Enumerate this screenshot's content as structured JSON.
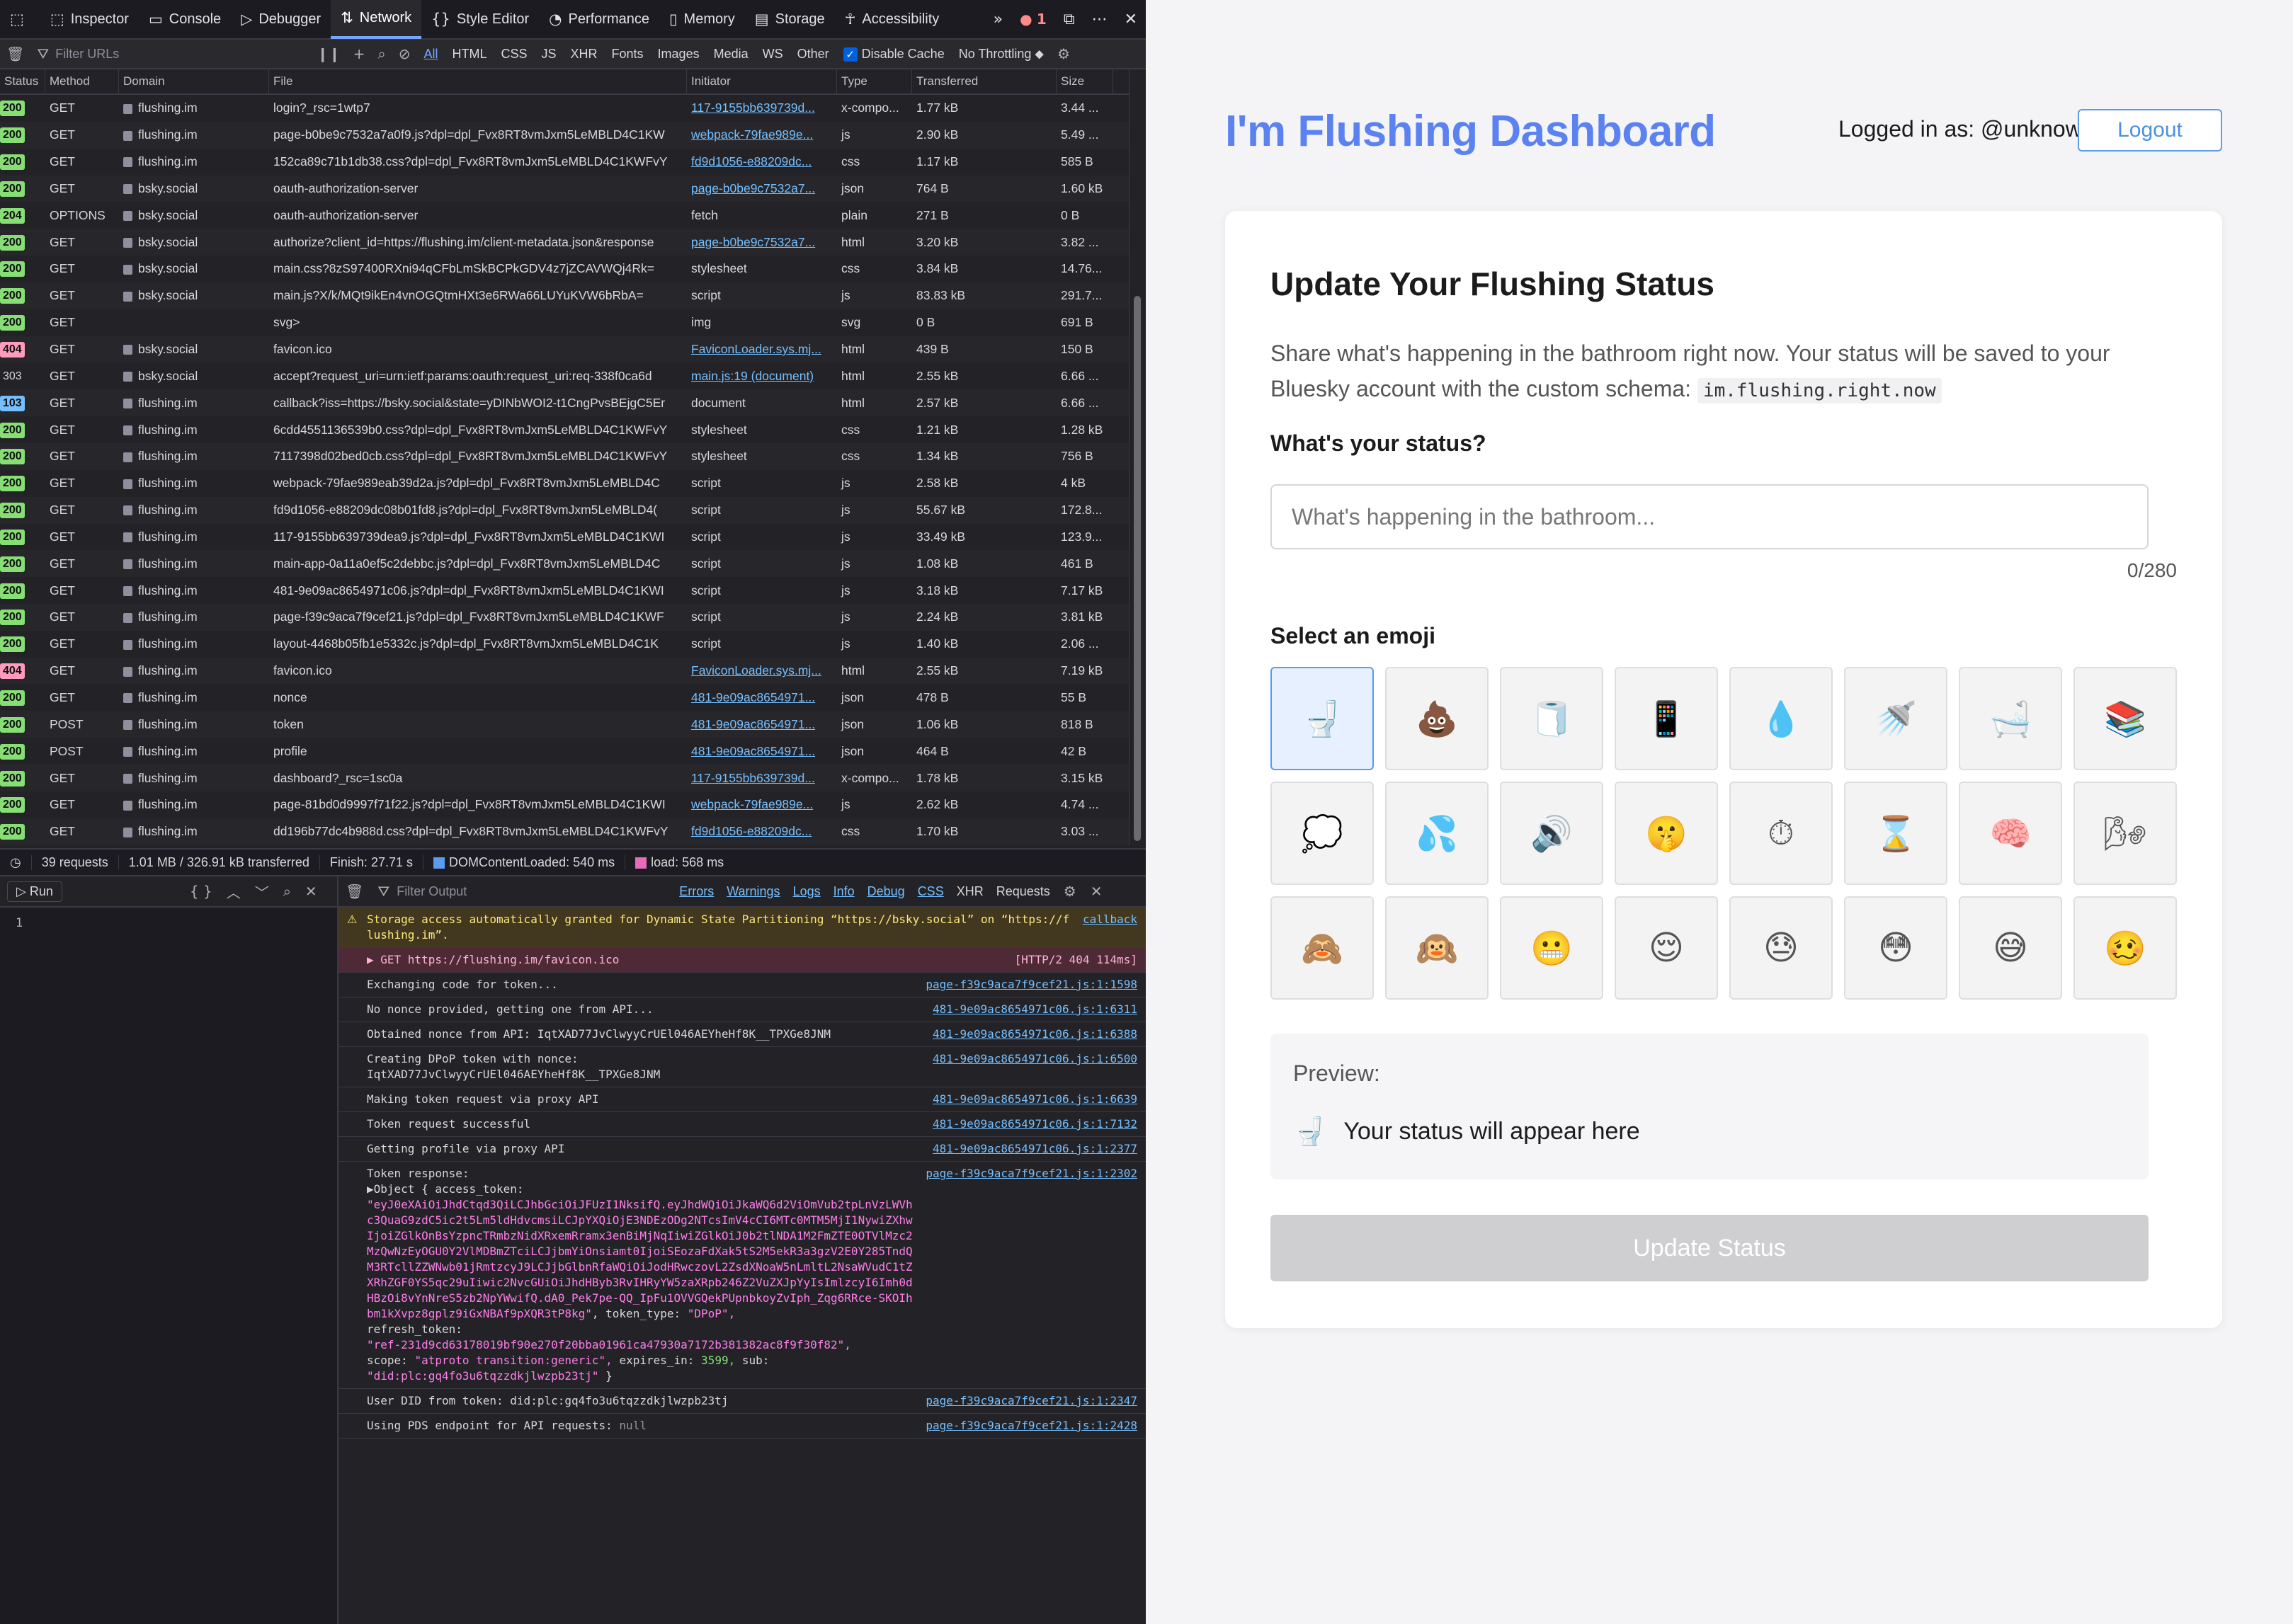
{
  "devtools": {
    "tools": [
      "Inspector",
      "Console",
      "Debugger",
      "Network",
      "Style Editor",
      "Performance",
      "Memory",
      "Storage",
      "Accessibility"
    ],
    "error_count": "1",
    "filter_placeholder": "Filter URLs",
    "filter_types": [
      "All",
      "HTML",
      "CSS",
      "JS",
      "XHR",
      "Fonts",
      "Images",
      "Media",
      "WS",
      "Other"
    ],
    "disable_cache": "Disable Cache",
    "throttling": "No Throttling ⬥",
    "columns": [
      "Status",
      "Method",
      "Domain",
      "File",
      "Initiator",
      "Type",
      "Transferred",
      "Size"
    ],
    "requests": [
      [
        "200",
        "GET",
        "flushing.im",
        "login?_rsc=1wtp7",
        "117-9155bb639739d...",
        "x-compo...",
        "1.77 kB",
        "3.44 ..."
      ],
      [
        "200",
        "GET",
        "flushing.im",
        "page-b0be9c7532a7a0f9.js?dpl=dpl_Fvx8RT8vmJxm5LeMBLD4C1KW",
        "webpack-79fae989e...",
        "js",
        "2.90 kB",
        "5.49 ..."
      ],
      [
        "200",
        "GET",
        "flushing.im",
        "152ca89c71b1db38.css?dpl=dpl_Fvx8RT8vmJxm5LeMBLD4C1KWFvY",
        "fd9d1056-e88209dc...",
        "css",
        "1.17 kB",
        "585 B"
      ],
      [
        "200",
        "GET",
        "bsky.social",
        "oauth-authorization-server",
        "page-b0be9c7532a7...",
        "json",
        "764 B",
        "1.60 kB"
      ],
      [
        "204",
        "OPTIONS",
        "bsky.social",
        "oauth-authorization-server",
        "fetch",
        "plain",
        "271 B",
        "0 B"
      ],
      [
        "200",
        "GET",
        "bsky.social",
        "authorize?client_id=https://flushing.im/client-metadata.json&response",
        "page-b0be9c7532a7...",
        "html",
        "3.20 kB",
        "3.82 ..."
      ],
      [
        "200",
        "GET",
        "bsky.social",
        "main.css?8zS97400RXni94qCFbLmSkBCPkGDV4z7jZCAVWQj4Rk=",
        "stylesheet",
        "css",
        "3.84 kB",
        "14.76..."
      ],
      [
        "200",
        "GET",
        "bsky.social",
        "main.js?X/k/MQt9ikEn4vnOGQtmHXt3e6RWa66LUYuKVW6bRbA=",
        "script",
        "js",
        "83.83 kB",
        "291.7..."
      ],
      [
        "200",
        "GET",
        "",
        "svg>",
        "img",
        "svg",
        "0 B",
        "691 B"
      ],
      [
        "404",
        "GET",
        "bsky.social",
        "favicon.ico",
        "FaviconLoader.sys.mj...",
        "html",
        "439 B",
        "150 B"
      ],
      [
        "303",
        "GET",
        "bsky.social",
        "accept?request_uri=urn:ietf:params:oauth:request_uri:req-338f0ca6d",
        "main.js:19 (document)",
        "html",
        "2.55 kB",
        "6.66 ..."
      ],
      [
        "103",
        "GET",
        "flushing.im",
        "callback?iss=https://bsky.social&state=yDINbWOI2-t1CngPvsBEjgC5Er",
        "document",
        "html",
        "2.57 kB",
        "6.66 ..."
      ],
      [
        "200",
        "GET",
        "flushing.im",
        "6cdd4551136539b0.css?dpl=dpl_Fvx8RT8vmJxm5LeMBLD4C1KWFvY",
        "stylesheet",
        "css",
        "1.21 kB",
        "1.28 kB"
      ],
      [
        "200",
        "GET",
        "flushing.im",
        "7117398d02bed0cb.css?dpl=dpl_Fvx8RT8vmJxm5LeMBLD4C1KWFvY",
        "stylesheet",
        "css",
        "1.34 kB",
        "756 B"
      ],
      [
        "200",
        "GET",
        "flushing.im",
        "webpack-79fae989eab39d2a.js?dpl=dpl_Fvx8RT8vmJxm5LeMBLD4C",
        "script",
        "js",
        "2.58 kB",
        "4 kB"
      ],
      [
        "200",
        "GET",
        "flushing.im",
        "fd9d1056-e88209dc08b01fd8.js?dpl=dpl_Fvx8RT8vmJxm5LeMBLD4(",
        "script",
        "js",
        "55.67 kB",
        "172.8..."
      ],
      [
        "200",
        "GET",
        "flushing.im",
        "117-9155bb639739dea9.js?dpl=dpl_Fvx8RT8vmJxm5LeMBLD4C1KWI",
        "script",
        "js",
        "33.49 kB",
        "123.9..."
      ],
      [
        "200",
        "GET",
        "flushing.im",
        "main-app-0a11a0ef5c2debbc.js?dpl=dpl_Fvx8RT8vmJxm5LeMBLD4C",
        "script",
        "js",
        "1.08 kB",
        "461 B"
      ],
      [
        "200",
        "GET",
        "flushing.im",
        "481-9e09ac8654971c06.js?dpl=dpl_Fvx8RT8vmJxm5LeMBLD4C1KWI",
        "script",
        "js",
        "3.18 kB",
        "7.17 kB"
      ],
      [
        "200",
        "GET",
        "flushing.im",
        "page-f39c9aca7f9cef21.js?dpl=dpl_Fvx8RT8vmJxm5LeMBLD4C1KWF",
        "script",
        "js",
        "2.24 kB",
        "3.81 kB"
      ],
      [
        "200",
        "GET",
        "flushing.im",
        "layout-4468b05fb1e5332c.js?dpl=dpl_Fvx8RT8vmJxm5LeMBLD4C1K",
        "script",
        "js",
        "1.40 kB",
        "2.06 ..."
      ],
      [
        "404",
        "GET",
        "flushing.im",
        "favicon.ico",
        "FaviconLoader.sys.mj...",
        "html",
        "2.55 kB",
        "7.19 kB"
      ],
      [
        "200",
        "GET",
        "flushing.im",
        "nonce",
        "481-9e09ac8654971...",
        "json",
        "478 B",
        "55 B"
      ],
      [
        "200",
        "POST",
        "flushing.im",
        "token",
        "481-9e09ac8654971...",
        "json",
        "1.06 kB",
        "818 B"
      ],
      [
        "200",
        "POST",
        "flushing.im",
        "profile",
        "481-9e09ac8654971...",
        "json",
        "464 B",
        "42 B"
      ],
      [
        "200",
        "GET",
        "flushing.im",
        "dashboard?_rsc=1sc0a",
        "117-9155bb639739d...",
        "x-compo...",
        "1.78 kB",
        "3.15 kB"
      ],
      [
        "200",
        "GET",
        "flushing.im",
        "page-81bd0d9997f71f22.js?dpl=dpl_Fvx8RT8vmJxm5LeMBLD4C1KWI",
        "webpack-79fae989e...",
        "js",
        "2.62 kB",
        "4.74 ..."
      ],
      [
        "200",
        "GET",
        "flushing.im",
        "dd196b77dc4b988d.css?dpl=dpl_Fvx8RT8vmJxm5LeMBLD4C1KWFvY",
        "fd9d1056-e88209dc...",
        "css",
        "1.70 kB",
        "3.03 ..."
      ]
    ],
    "status_colors": {
      "200": "#86de74",
      "204": "#86de74",
      "404": "#ff9bbd",
      "303": "#d7d7db",
      "103": "#75bfff"
    },
    "summary": {
      "requests": "39 requests",
      "transferred": "1.01 MB / 326.91 kB transferred",
      "finish": "Finish: 27.71 s",
      "dcl": "DOMContentLoaded: 540 ms",
      "load": "load: 568 ms"
    },
    "editor": {
      "run": "Run",
      "line": "1"
    },
    "console": {
      "filter_placeholder": "Filter Output",
      "filters": [
        "Errors",
        "Warnings",
        "Logs",
        "Info",
        "Debug",
        "CSS",
        "XHR",
        "Requests"
      ],
      "messages": [
        {
          "kind": "warn",
          "text": "Storage access automatically granted for Dynamic State Partitioning “https://bsky.social” on “https://flushing.im”.",
          "src": "callback"
        },
        {
          "kind": "err",
          "text": "▶ GET https://flushing.im/favicon.ico",
          "src": "[HTTP/2 404  114ms]"
        },
        {
          "kind": "log",
          "text": "Exchanging code for token...",
          "src": "page-f39c9aca7f9cef21.js:1:1598"
        },
        {
          "kind": "log",
          "text": "No nonce provided, getting one from API...",
          "src": "481-9e09ac8654971c06.js:1:6311"
        },
        {
          "kind": "log",
          "text": "Obtained nonce from API: IqtXAD77JvClwyyCrUEl046AEYheHf8K__TPXGe8JNM",
          "src": "481-9e09ac8654971c06.js:1:6388"
        },
        {
          "kind": "log",
          "text": "Creating DPoP token with nonce:\nIqtXAD77JvClwyyCrUEl046AEYheHf8K__TPXGe8JNM",
          "src": "481-9e09ac8654971c06.js:1:6500"
        },
        {
          "kind": "log",
          "text": "Making token request via proxy API",
          "src": "481-9e09ac8654971c06.js:1:6639"
        },
        {
          "kind": "log",
          "text": "Token request successful",
          "src": "481-9e09ac8654971c06.js:1:7132"
        },
        {
          "kind": "log",
          "text": "Getting profile via proxy API",
          "src": "481-9e09ac8654971c06.js:1:2377"
        }
      ],
      "token_label": "Token response:",
      "token_src": "page-f39c9aca7f9cef21.js:1:2302",
      "token_object": "▶Object { access_token:",
      "access_token": "\"eyJ0eXAiOiJhdCtqd3QiLCJhbGciOiJFUzI1NksifQ.eyJhdWQiOiJkaWQ6d2ViOmVub2tpLnVzLWVhc3QuaG9zdC5ic2t5Lm5ldHdvcmsiLCJpYXQiOjE3NDEzODg2NTcsImV4cCI6MTc0MTM5MjI1NywiZXhwIjoiZGlkOnBsYzpncTRmbzNidXRxemRramx3enBiMjNqIiwiZGlkOiJ0b2tlNDA1M2FmZTE0OTVlMzc2MzQwNzEyOGU0Y2VlMDBmZTciLCJjbmYiOnsiamt0IjoiSEozaFdXak5tS2M5ekR3a3gzV2E0Y285TndQM3RTcllZZWNwb01jRmtzcyJ9LCJjbGlbnRfaWQiOiJodHRwczovL2ZsdXNoaW5nLmltL2NsaWVudC1tZXRhZGF0YS5qc29uIiwic2NvcGUiOiJhdHByb3RvIHRyYW5zaXRpb246Z2VuZXJpYyIsImlzcyI6Imh0dHBzOi8vYnNreS5zb2NpYWwifQ.dA0_Pek7pe-QQ_IpFu1OVVGQekPUpnbkoyZvIph_Zqg6RRce-SKOIhbm1kXvpz8gplz9iGxNBAf9pXQR3tP8kg\"",
      "token_type_key": ", token_type:",
      "token_type": "\"DPoP\",",
      "refresh_key": "refresh_token:",
      "refresh_token": "\"ref-231d9cd63178019bf90e270f20bba01961ca47930a7172b381382ac8f9f30f82\",",
      "scope_key": "scope:",
      "scope": "\"atproto transition:generic\",",
      "expires_key": "expires_in:",
      "expires": "3599,",
      "sub_key": "sub:",
      "sub": "\"did:plc:gq4fo3u6tqzzdkjlwzpb23tj\"",
      "closing": "}",
      "after": [
        {
          "text": "User DID from token: did:plc:gq4fo3u6tqzzdkjlwzpb23tj",
          "src": "page-f39c9aca7f9cef21.js:1:2347"
        },
        {
          "text": "Using PDS endpoint for API requests:",
          "null": "null",
          "src": "page-f39c9aca7f9cef21.js:1:2428"
        }
      ]
    }
  },
  "app": {
    "title": "I'm Flushing Dashboard",
    "logged_in": "Logged in as: @unknown",
    "logout": "Logout",
    "card_title": "Update Your Flushing Status",
    "description": "Share what's happening in the bathroom right now. Your status will be saved to your Bluesky account with the custom schema:",
    "schema": "im.flushing.right.now",
    "status_label": "What's your status?",
    "status_placeholder": "What's happening in the bathroom...",
    "char_count": "0/280",
    "emoji_label": "Select an emoji",
    "emojis": [
      "toilet-icon",
      "poop-icon",
      "toilet-paper-icon",
      "phone-icon",
      "droplet-icon",
      "shower-icon",
      "bathtub-icon",
      "books-icon",
      "thought-bubble-icon",
      "sweat-drops-icon",
      "speaker-icon",
      "shushing-face-icon",
      "stopwatch-icon",
      "hourglass-icon",
      "brain-icon",
      "wind-face-icon",
      "see-no-evil-icon",
      "hear-no-evil-icon",
      "grimacing-face-icon",
      "relieved-face-icon",
      "downcast-sweat-icon",
      "flushed-face-icon",
      "grinning-sweat-icon",
      "woozy-face-icon"
    ],
    "selected_emoji": 0,
    "preview_label": "Preview:",
    "preview_text": "Your status will appear here",
    "update_button": "Update Status",
    "accent": "#5b82f0"
  }
}
